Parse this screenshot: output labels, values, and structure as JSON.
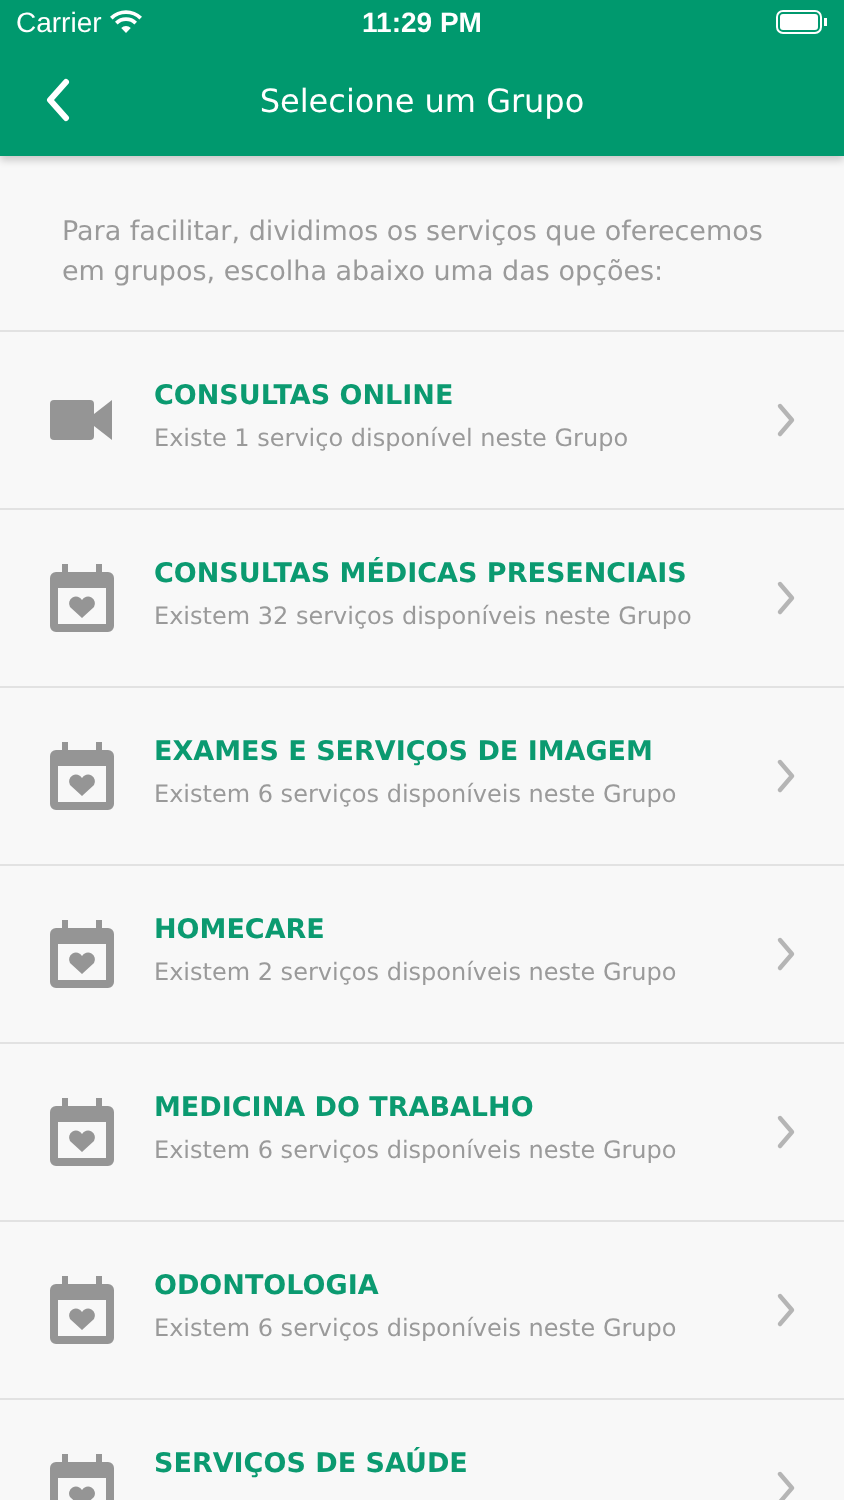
{
  "status_bar": {
    "carrier": "Carrier",
    "time": "11:29 PM"
  },
  "header": {
    "title": "Selecione um Grupo"
  },
  "intro": "Para facilitar, dividimos os serviços que oferecemos em grupos, escolha abaixo uma das opções:",
  "groups": [
    {
      "kind": "video",
      "title": "CONSULTAS ONLINE",
      "subtitle": "Existe 1 serviço disponível neste Grupo"
    },
    {
      "kind": "calendar",
      "title": "CONSULTAS MÉDICAS PRESENCIAIS",
      "subtitle": "Existem 32 serviços disponíveis neste Grupo"
    },
    {
      "kind": "calendar",
      "title": "EXAMES E SERVIÇOS DE IMAGEM",
      "subtitle": "Existem 6 serviços disponíveis neste Grupo"
    },
    {
      "kind": "calendar",
      "title": "HOMECARE",
      "subtitle": "Existem 2 serviços disponíveis neste Grupo"
    },
    {
      "kind": "calendar",
      "title": "MEDICINA DO TRABALHO",
      "subtitle": "Existem 6 serviços disponíveis neste Grupo"
    },
    {
      "kind": "calendar",
      "title": "ODONTOLOGIA",
      "subtitle": "Existem 6 serviços disponíveis neste Grupo"
    },
    {
      "kind": "calendar",
      "title": "SERVIÇOS DE SAÚDE"
    }
  ]
}
